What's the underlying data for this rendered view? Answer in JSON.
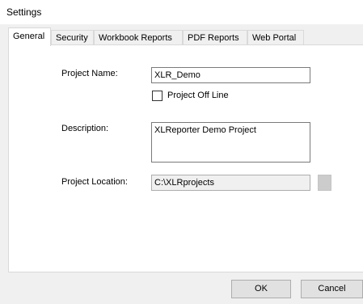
{
  "window": {
    "title": "Settings"
  },
  "tabs": [
    {
      "label": "General",
      "active": true
    },
    {
      "label": "Security"
    },
    {
      "label": "Workbook Reports"
    },
    {
      "label": "PDF Reports"
    },
    {
      "label": "Web Portal"
    }
  ],
  "form": {
    "project_name_label": "Project Name:",
    "project_name_value": "XLR_Demo",
    "offline_checkbox_label": "Project Off Line",
    "offline_checked": false,
    "description_label": "Description:",
    "description_value": "XLReporter Demo Project",
    "location_label": "Project Location:",
    "location_value": "C:\\XLRprojects"
  },
  "buttons": {
    "ok_label": "OK",
    "cancel_label": "Cancel"
  },
  "colors": {
    "panel_bg": "#ffffff",
    "dialog_bg": "#f0f0f0",
    "border": "#7a7a7a"
  }
}
